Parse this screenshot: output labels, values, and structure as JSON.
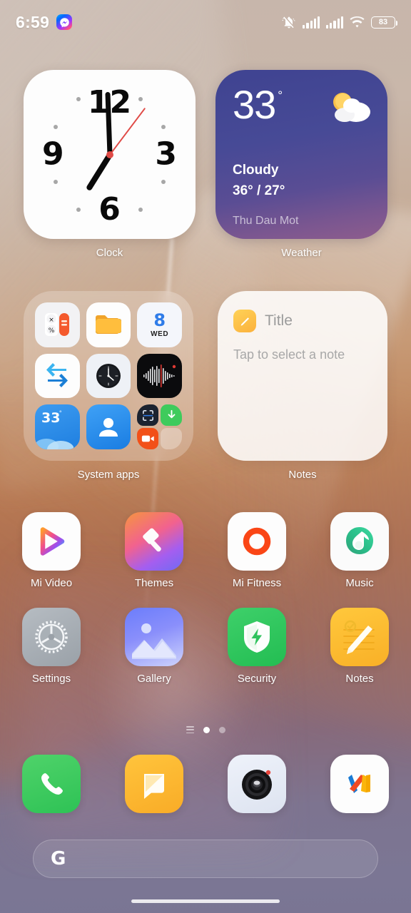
{
  "status_bar": {
    "time": "6:59",
    "notification_icon": "messenger-icon",
    "icons": [
      "vibrate-off-icon",
      "signal-sim1-icon",
      "signal-sim2-icon",
      "wifi-icon"
    ],
    "battery_level": "83"
  },
  "widgets": {
    "clock": {
      "label": "Clock",
      "numbers": [
        "12",
        "3",
        "6",
        "9"
      ],
      "hour_angle": 212,
      "minute_angle": -2,
      "second_angle": 37,
      "second_hand_color": "#e04a46"
    },
    "weather": {
      "label": "Weather",
      "temperature": "33",
      "degree_symbol": "°",
      "condition": "Cloudy",
      "high_low": "36° / 27°",
      "location": "Thu Dau Mot",
      "icon": "partly-cloudy-icon",
      "accent": "#474a96"
    },
    "notes": {
      "label": "Notes",
      "title": "Title",
      "placeholder": "Tap to select a note",
      "icon": "note-pencil-icon"
    }
  },
  "folder": {
    "label": "System apps",
    "items": [
      {
        "name": "calculator",
        "icon": "calculator-icon"
      },
      {
        "name": "file-manager",
        "icon": "folder-icon"
      },
      {
        "name": "calendar",
        "icon": "calendar-icon",
        "day": "8",
        "weekday": "WED"
      },
      {
        "name": "shareme",
        "icon": "transfer-arrows-icon"
      },
      {
        "name": "clock",
        "icon": "analog-clock-icon"
      },
      {
        "name": "recorder",
        "icon": "waveform-icon"
      },
      {
        "name": "weather",
        "icon": "weather-tile-icon",
        "temperature": "33",
        "degree_symbol": "°"
      },
      {
        "name": "contacts",
        "icon": "person-icon"
      },
      {
        "name": "mini-group",
        "icon": "app-group-icon",
        "sub_items": [
          {
            "name": "scanner",
            "icon": "scan-frame-icon"
          },
          {
            "name": "downloads",
            "icon": "download-arrow-icon"
          },
          {
            "name": "screen-recorder",
            "icon": "video-camera-icon"
          },
          {
            "name": "empty-slot",
            "icon": "empty-icon"
          }
        ]
      }
    ]
  },
  "app_grid": [
    [
      {
        "label": "Mi Video",
        "icon": "play-triangle-icon"
      },
      {
        "label": "Themes",
        "icon": "paint-brush-icon"
      },
      {
        "label": "Mi Fitness",
        "icon": "ring-icon"
      },
      {
        "label": "Music",
        "icon": "music-note-icon"
      }
    ],
    [
      {
        "label": "Settings",
        "icon": "gear-icon"
      },
      {
        "label": "Gallery",
        "icon": "photo-icon"
      },
      {
        "label": "Security",
        "icon": "shield-bolt-icon"
      },
      {
        "label": "Notes",
        "icon": "notepad-pencil-icon"
      }
    ]
  ],
  "page_indicator": {
    "menu_icon": "list-lines-icon",
    "total_pages": 2,
    "active_page": 1
  },
  "dock": [
    {
      "name": "phone",
      "icon": "phone-handset-icon"
    },
    {
      "name": "messages",
      "icon": "message-bubble-icon"
    },
    {
      "name": "camera",
      "icon": "camera-lens-icon"
    },
    {
      "name": "mi-apps",
      "icon": "mi-logo-icon"
    }
  ],
  "search": {
    "logo": "G",
    "placeholder": ""
  }
}
